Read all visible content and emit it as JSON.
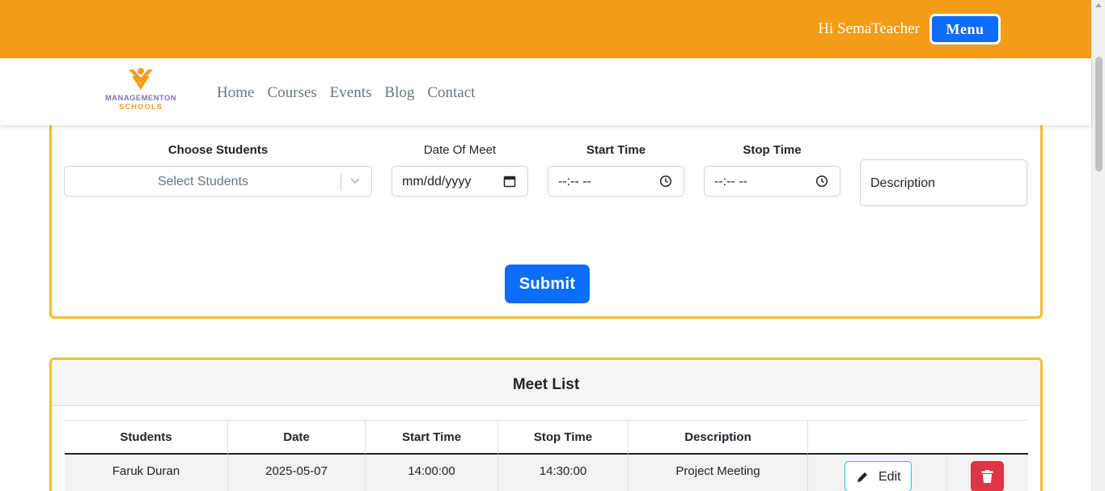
{
  "header": {
    "greeting": "Hi SemaTeacher",
    "menu_label": "Menu"
  },
  "brand": {
    "line1": "MANAGEMENTON",
    "line2": "SCHOOLS"
  },
  "nav": {
    "items": [
      "Home",
      "Courses",
      "Events",
      "Blog",
      "Contact"
    ]
  },
  "form": {
    "students_label": "Choose Students",
    "students_placeholder": "Select Students",
    "date_label": "Date Of Meet",
    "date_placeholder": "mm/dd/yyyy",
    "start_label": "Start Time",
    "start_placeholder": "--:-- --",
    "stop_label": "Stop Time",
    "stop_placeholder": "--:-- --",
    "description_placeholder": "Description",
    "submit_label": "Submit"
  },
  "meet_list": {
    "title": "Meet List",
    "columns": [
      "Students",
      "Date",
      "Start Time",
      "Stop Time",
      "Description"
    ],
    "rows": [
      {
        "students": "Faruk Duran",
        "date": "2025-05-07",
        "start_time": "14:00:00",
        "stop_time": "14:30:00",
        "description": "Project Meeting",
        "edit_label": "Edit"
      }
    ]
  },
  "colors": {
    "topbar": "#f39c1a",
    "card_border": "#f5bf2a",
    "primary": "#0d6efd",
    "danger": "#dc3545",
    "info": "#0dcaf0"
  },
  "icons": [
    "chevron-down-icon",
    "calendar-icon",
    "clock-icon",
    "pencil-icon",
    "trash-icon",
    "logo-icon"
  ]
}
